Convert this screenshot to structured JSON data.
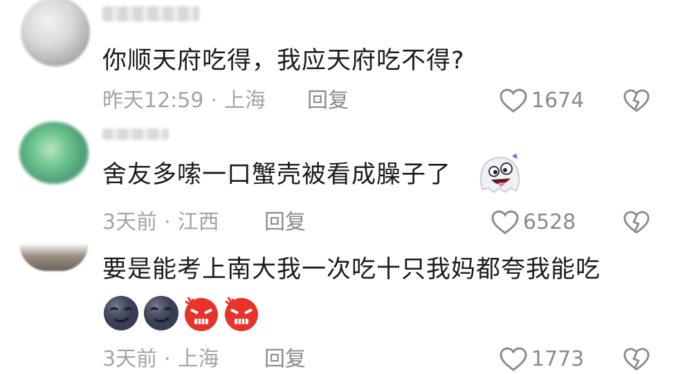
{
  "comments": [
    {
      "text": "你顺天府吃得，我应天府吃不得?",
      "time": "昨天12:59",
      "location": "上海",
      "reply_label": "回复",
      "likes": "1674"
    },
    {
      "text": "舍友多嗦一口蟹壳被看成臊子了",
      "time": "3天前",
      "location": "江西",
      "reply_label": "回复",
      "likes": "6528"
    },
    {
      "text": "要是能考上南大我一次吃十只我妈都夸我能吃",
      "time": "3天前",
      "location": "上海",
      "reply_label": "回复",
      "likes": "1773"
    }
  ],
  "meta_separator": "·",
  "icons": {
    "like": "heart-outline-icon",
    "dislike": "broken-heart-icon",
    "emoji_dark": "dark-smirk-face-emoji",
    "emoji_angry": "angry-face-emoji",
    "sticker": "crazy-ghost-face-sticker"
  },
  "colors": {
    "text": "#1b1b1b",
    "meta": "#a4a4a4",
    "icon": "#8a8a8a"
  }
}
